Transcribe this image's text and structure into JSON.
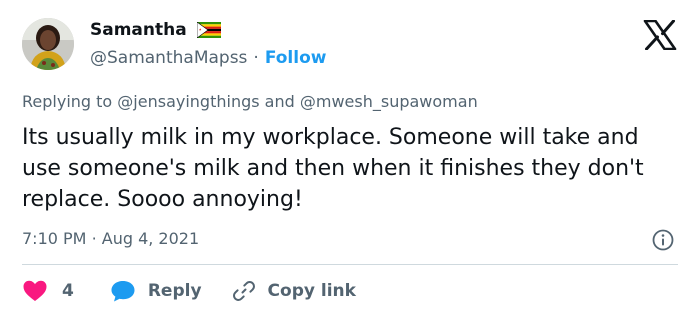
{
  "author": {
    "display_name": "Samantha",
    "handle": "@SamanthaMapss",
    "separator": "·",
    "follow_label": "Follow",
    "flag_icon": "zimbabwe-flag-icon"
  },
  "reply_context": {
    "prefix": "Replying to",
    "mention_1": "@jensayingthings",
    "joiner": "and",
    "mention_2": "@mwesh_supawoman"
  },
  "tweet": {
    "text": "Its usually milk in my workplace. Someone will take and use someone's milk and then when it finishes they don't replace. Soooo annoying!",
    "time": "7:10 PM",
    "separator": "·",
    "date": "Aug 4, 2021"
  },
  "actions": {
    "like_count": "4",
    "reply_label": "Reply",
    "copy_label": "Copy link"
  },
  "colors": {
    "accent": "#1d9bf0",
    "like": "#f91880",
    "text_primary": "#0f1419",
    "text_secondary": "#536471",
    "divider": "#cfd9de"
  }
}
